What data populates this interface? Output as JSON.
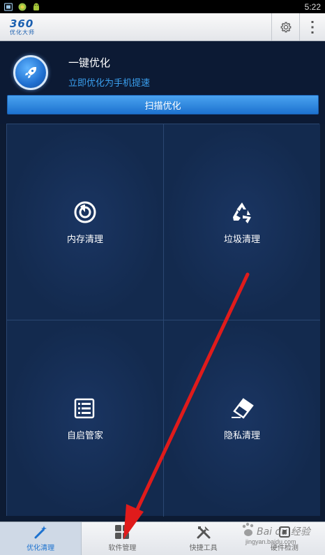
{
  "status_bar": {
    "time": "5:22",
    "icons": [
      "gallery-icon",
      "app-icon",
      "android-icon"
    ]
  },
  "app_bar": {
    "logo_big": "360",
    "logo_small": "优化大师",
    "settings_icon": "gear-icon",
    "menu_icon": "overflow-menu-icon"
  },
  "hero": {
    "title": "一键优化",
    "subtitle": "立即优化为手机提速",
    "button_label": "扫描优化",
    "icon": "rocket-icon"
  },
  "grid": {
    "items": [
      {
        "label": "内存清理",
        "icon": "memory-clean-icon"
      },
      {
        "label": "垃圾清理",
        "icon": "recycle-icon"
      },
      {
        "label": "自启管家",
        "icon": "autostart-list-icon"
      },
      {
        "label": "隐私清理",
        "icon": "eraser-icon"
      }
    ]
  },
  "bottom_nav": {
    "items": [
      {
        "label": "优化清理",
        "icon": "magic-wand-icon",
        "active": true
      },
      {
        "label": "软件管理",
        "icon": "app-grid-icon",
        "active": false
      },
      {
        "label": "快捷工具",
        "icon": "tools-icon",
        "active": false
      },
      {
        "label": "硬件检测",
        "icon": "hardware-check-icon",
        "active": false
      }
    ]
  },
  "watermark": {
    "brand": "Bai du 经验",
    "url": "jingyan.baidu.com"
  },
  "colors": {
    "accent": "#1d72cf",
    "subtitle_blue": "#3aa0f0",
    "background": "#0d1b33",
    "annotation_arrow": "#e01b1b"
  }
}
